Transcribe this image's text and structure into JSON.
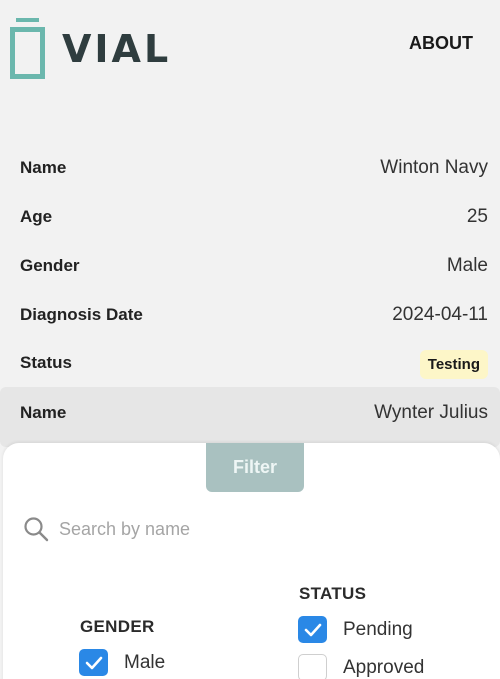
{
  "header": {
    "logo_text": "VIAL",
    "about_label": "ABOUT"
  },
  "records": [
    {
      "fields": [
        {
          "label": "Name",
          "value": "Winton Navy"
        },
        {
          "label": "Age",
          "value": "25"
        },
        {
          "label": "Gender",
          "value": "Male"
        },
        {
          "label": "Diagnosis Date",
          "value": "2024-04-11"
        },
        {
          "label": "Status",
          "value": "Testing"
        }
      ]
    },
    {
      "fields": [
        {
          "label": "Name",
          "value": "Wynter Julius"
        }
      ]
    }
  ],
  "filter": {
    "button_label": "Filter",
    "search_placeholder": "Search by name",
    "gender": {
      "title": "GENDER",
      "options": [
        {
          "label": "Male",
          "checked": true
        }
      ]
    },
    "status": {
      "title": "STATUS",
      "options": [
        {
          "label": "Pending",
          "checked": true
        },
        {
          "label": "Approved",
          "checked": false
        }
      ]
    }
  },
  "colors": {
    "accent": "#6bb7ad",
    "checkbox": "#2a88e6",
    "badge_bg": "#fdf6c8",
    "filter_button": "#a9c1c0"
  }
}
